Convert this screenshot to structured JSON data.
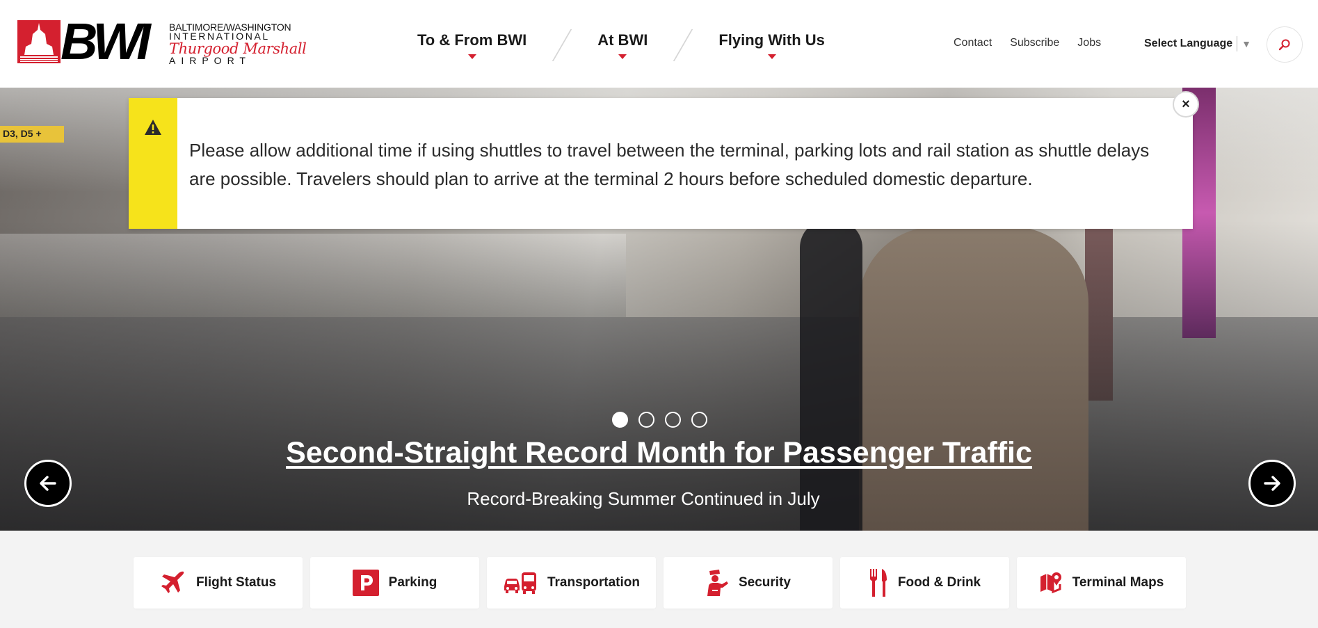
{
  "logo": {
    "mark": "BWI",
    "line1": "BALTIMORE/WASHINGTON",
    "line2": "INTERNATIONAL",
    "line3": "Thurgood Marshall",
    "line4": "AIRPORT",
    "brand_color": "#d4202f"
  },
  "nav": {
    "items": [
      {
        "label": "To & From BWI"
      },
      {
        "label": "At BWI"
      },
      {
        "label": "Flying With Us"
      }
    ],
    "util": [
      "Contact",
      "Subscribe",
      "Jobs"
    ],
    "language_label": "Select Language",
    "language_dropdown_icon": "triangle-down-icon",
    "search_icon": "search-icon"
  },
  "alert": {
    "message": "Please allow additional time if using shuttles to travel between the terminal, parking lots and rail station as shuttle delays are possible. Travelers should plan to arrive at the terminal 2 hours before scheduled domestic departure.",
    "stripe_color": "#f6e31b",
    "icon": "warning-icon",
    "close_label": "×"
  },
  "hero": {
    "sign_text": "D3, D5 +",
    "headline": "Second-Straight Record Month for Passenger Traffic",
    "subheadline": "Record-Breaking Summer Continued in July",
    "slide_count": 4,
    "active_slide": 1
  },
  "quick_links": [
    {
      "label": "Flight Status",
      "icon": "airplane-icon"
    },
    {
      "label": "Parking",
      "icon": "parking-icon"
    },
    {
      "label": "Transportation",
      "icon": "car-bus-icon"
    },
    {
      "label": "Security",
      "icon": "security-officer-icon"
    },
    {
      "label": "Food & Drink",
      "icon": "fork-knife-icon"
    },
    {
      "label": "Terminal Maps",
      "icon": "map-pin-icon"
    }
  ]
}
